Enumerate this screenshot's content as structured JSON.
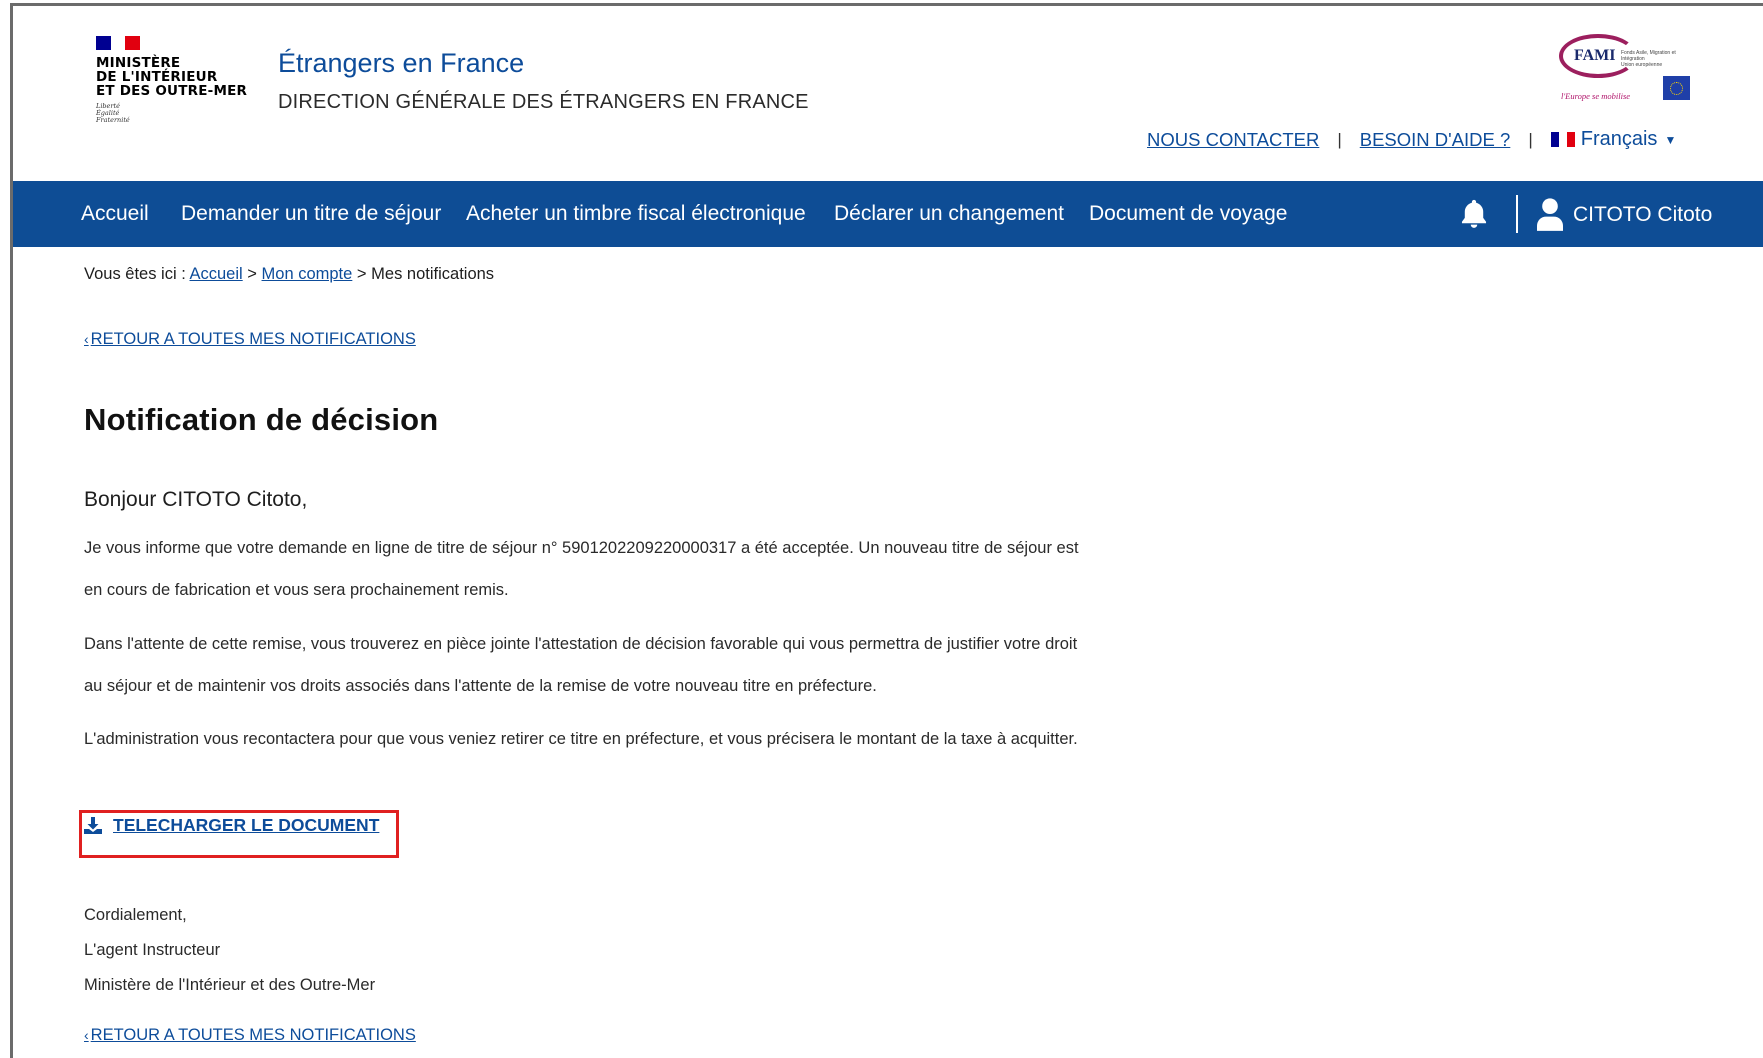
{
  "header": {
    "logo_lines": [
      "MINISTÈRE",
      "DE L'INTÉRIEUR",
      "ET DES OUTRE-MER"
    ],
    "logo_motto": [
      "Liberté",
      "Égalité",
      "Fraternité"
    ],
    "site_title": "Étrangers en France",
    "site_subtitle": "DIRECTION GÉNÉRALE DES ÉTRANGERS EN FRANCE",
    "fami": {
      "name": "FAMI",
      "small_text": "Fonds Asile, Migration et Intégration",
      "small_sub": "Union européenne",
      "tagline": "l'Europe se mobilise"
    },
    "links": {
      "contact": "NOUS CONTACTER",
      "help": "BESOIN D'AIDE ?",
      "separator": "|",
      "language": "Français"
    }
  },
  "nav": {
    "items": [
      "Accueil",
      "Demander un titre de séjour",
      "Acheter un timbre fiscal électronique",
      "Déclarer un changement",
      "Document de voyage"
    ],
    "user_name": "CITOTO Citoto"
  },
  "breadcrumb": {
    "prefix": "Vous êtes ici :",
    "home": "Accueil",
    "account": "Mon compte",
    "current": "Mes notifications",
    "separator": ">"
  },
  "back_link": "RETOUR A TOUTES MES NOTIFICATIONS",
  "page_title": "Notification de décision",
  "greeting": "Bonjour CITOTO Citoto,",
  "paragraphs": [
    "Je vous informe que votre demande en ligne de titre de séjour n° 5901202209220000317 a été acceptée. Un nouveau titre de séjour est en cours de fabrication et vous sera prochainement remis.",
    "Dans l'attente de cette remise, vous trouverez en pièce jointe l'attestation de décision favorable qui vous permettra de justifier votre droit au séjour et de maintenir vos droits associés dans l'attente de la remise de votre nouveau titre en préfecture.",
    "L'administration vous recontactera pour que vous veniez retirer ce titre en préfecture, et vous précisera le montant de la taxe à acquitter."
  ],
  "download_label": "TELECHARGER LE DOCUMENT",
  "signature": [
    "Cordialement,",
    "L'agent Instructeur",
    "Ministère de l'Intérieur et des Outre-Mer"
  ],
  "colors": {
    "nav_bg": "#0e4d95",
    "link": "#0d4c9a",
    "highlight_box": "#e02020",
    "flag_blue": "#000091",
    "flag_red": "#e1000f"
  },
  "icons": [
    "bell-icon",
    "user-icon",
    "download-icon",
    "chevron-left-icon",
    "caret-down-icon",
    "french-flag-icon",
    "eu-flag-icon"
  ]
}
